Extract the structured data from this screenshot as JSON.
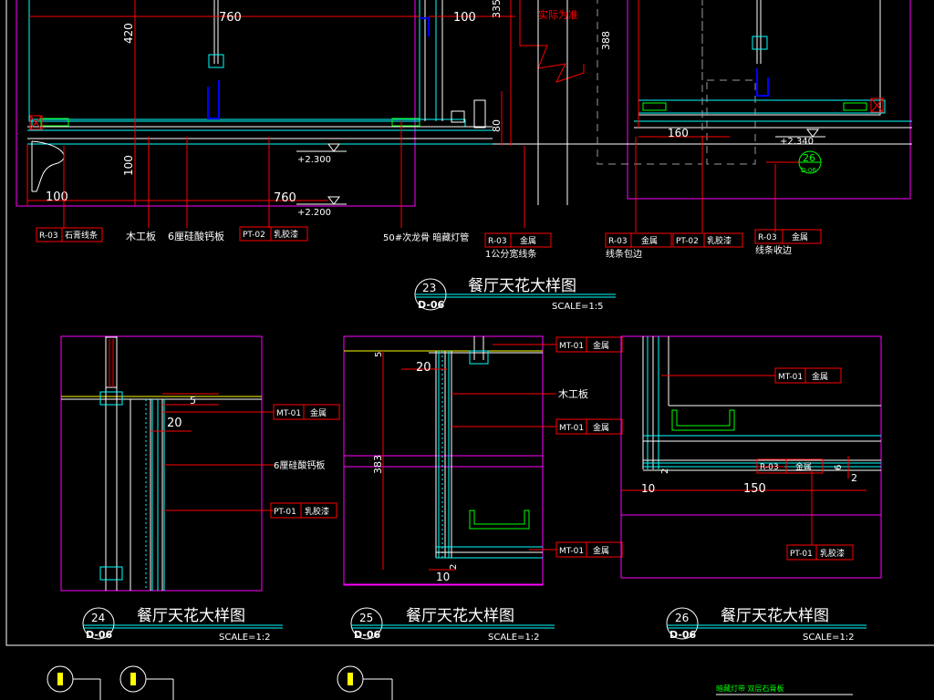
{
  "colors": {
    "background": "#000000",
    "frame": "#ff00ff",
    "dimension": "#ff0000",
    "text": "#ffffff",
    "structure": "#00ffff",
    "channel": "#00ff00",
    "hanger": "#0000ff",
    "ceiling_line": "#ffff00"
  },
  "top_detail": {
    "dims": {
      "d760_top": "760",
      "d100_top": "100",
      "d335": "335",
      "d420": "420",
      "d388": "388",
      "d80": "80",
      "d160": "160",
      "d100_left": "100",
      "d100_bottom": "100",
      "d760_bottom": "760"
    },
    "note_actual": "实际为准",
    "levels": {
      "l2300": "+2.300",
      "l2200": "+2.200",
      "l2340": "+2.340"
    },
    "callout_ref": {
      "number": "26",
      "sheet": "D-06"
    },
    "tags": [
      {
        "code": "R-03",
        "name": "石膏线条"
      },
      {
        "code": "PT-02",
        "name": "乳胶漆"
      },
      {
        "code": "R-03",
        "name": "金属"
      },
      {
        "code": "R-03",
        "name": "金属"
      },
      {
        "code": "PT-02",
        "name": "乳胶漆"
      },
      {
        "code": "R-03",
        "name": "金属"
      }
    ],
    "labels": {
      "wood_board": "木工板",
      "cal_board": "6厘硅酸钙板",
      "keel": "50#次龙骨 暗藏灯管",
      "trim_1cm": "1公分宽线条",
      "trim_edge": "线条包边",
      "trim_finish": "线条收边"
    },
    "title": {
      "number": "23",
      "sheet": "D-06",
      "text": "餐厅天花大样图",
      "scale": "SCALE=1:5"
    }
  },
  "detail_24": {
    "dims": {
      "d5": "5",
      "d20": "20"
    },
    "tags": [
      {
        "code": "MT-01",
        "name": "金属"
      },
      {
        "code": "PT-01",
        "name": "乳胶漆"
      }
    ],
    "label_cal_board": "6厘硅酸钙板",
    "title": {
      "number": "24",
      "sheet": "D-06",
      "text": "餐厅天花大样图",
      "scale": "SCALE=1:2"
    }
  },
  "detail_25": {
    "dims": {
      "d5": "5",
      "d20": "20",
      "d383": "383",
      "d10": "10",
      "d2": "2"
    },
    "tags": [
      {
        "code": "MT-01",
        "name": "金属"
      },
      {
        "code": "MT-01",
        "name": "金属"
      },
      {
        "code": "MT-01",
        "name": "金属"
      }
    ],
    "label_wood_board": "木工板",
    "title": {
      "number": "25",
      "sheet": "D-06",
      "text": "餐厅天花大样图",
      "scale": "SCALE=1:2"
    }
  },
  "detail_26": {
    "dims": {
      "d2_left": "2",
      "d10": "10",
      "d150": "150",
      "d6": "6",
      "d2_right": "2"
    },
    "tags": [
      {
        "code": "MT-01",
        "name": "金属"
      },
      {
        "code": "R-03",
        "name": "金属"
      },
      {
        "code": "PT-01",
        "name": "乳胶漆"
      }
    ],
    "title": {
      "number": "26",
      "sheet": "D-06",
      "text": "餐厅天花大样图",
      "scale": "SCALE=1:2"
    }
  },
  "bottom_strip": {
    "green_note": "暗藏灯带  双层石膏板"
  }
}
